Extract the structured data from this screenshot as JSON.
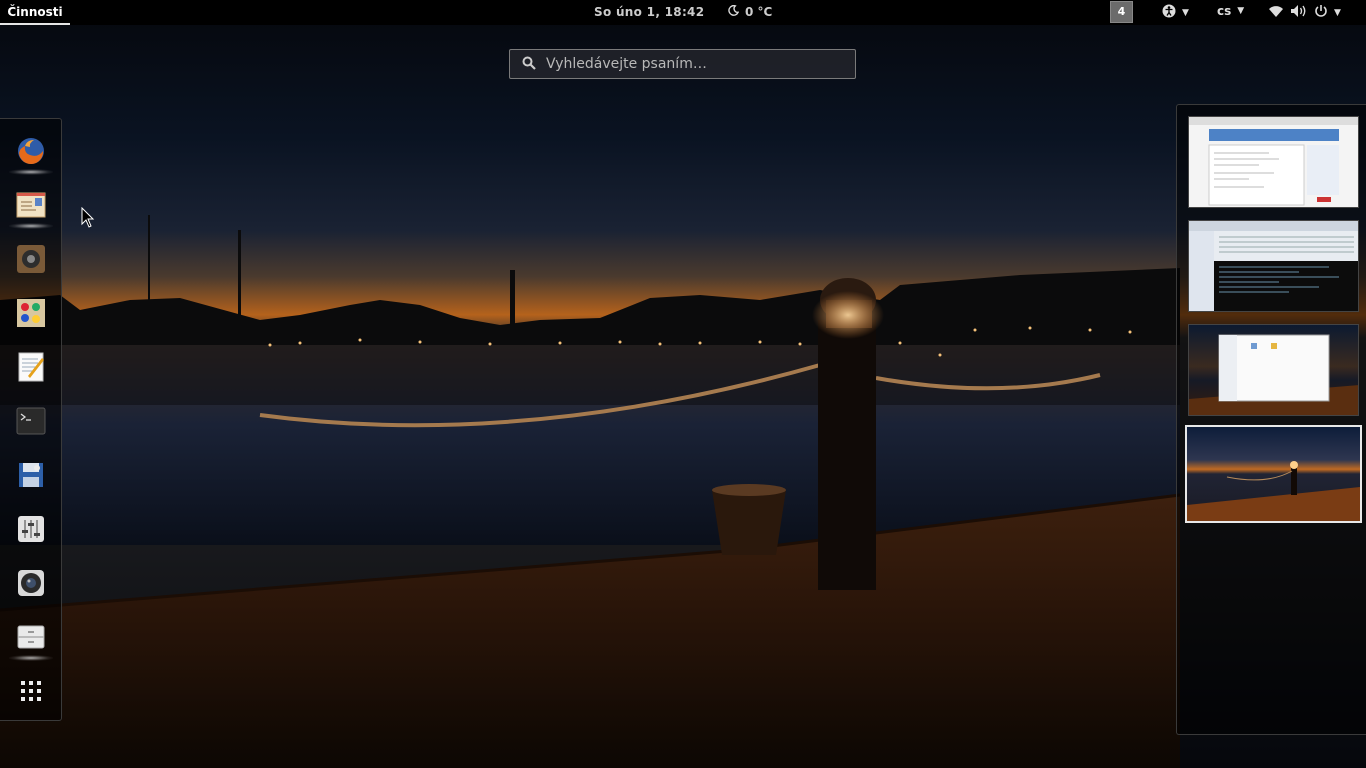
{
  "topbar": {
    "activities_label": "Činnosti",
    "clock": "So úno  1, 18:42",
    "weather_icon": "moon-icon",
    "weather_temp": "0 °C",
    "workspace_badge": "4",
    "accessibility_icon": "accessibility-icon",
    "keyboard_layout": "cs",
    "wifi_icon": "wifi-icon",
    "volume_icon": "volume-icon",
    "power_icon": "power-icon"
  },
  "search": {
    "placeholder": "Vyhledávejte psaním…"
  },
  "dash": {
    "items": [
      {
        "name": "firefox-icon",
        "running": true
      },
      {
        "name": "mail-icon",
        "running": true
      },
      {
        "name": "speaker-icon",
        "running": false
      },
      {
        "name": "paint-icon",
        "running": false
      },
      {
        "name": "text-editor-icon",
        "running": false
      },
      {
        "name": "terminal-icon",
        "running": false
      },
      {
        "name": "installer-icon",
        "running": false
      },
      {
        "name": "settings-sliders-icon",
        "running": false
      },
      {
        "name": "camera-icon",
        "running": false
      },
      {
        "name": "files-icon",
        "running": true
      },
      {
        "name": "show-apps-grid-icon",
        "running": false
      }
    ]
  },
  "workspaces": {
    "count": 4,
    "active_index": 3
  },
  "colors": {
    "topbar_bg": "#000000",
    "sky_top": "#05070c",
    "sunset_orange": "#b5621c",
    "dock_wood": "#2a1509"
  }
}
